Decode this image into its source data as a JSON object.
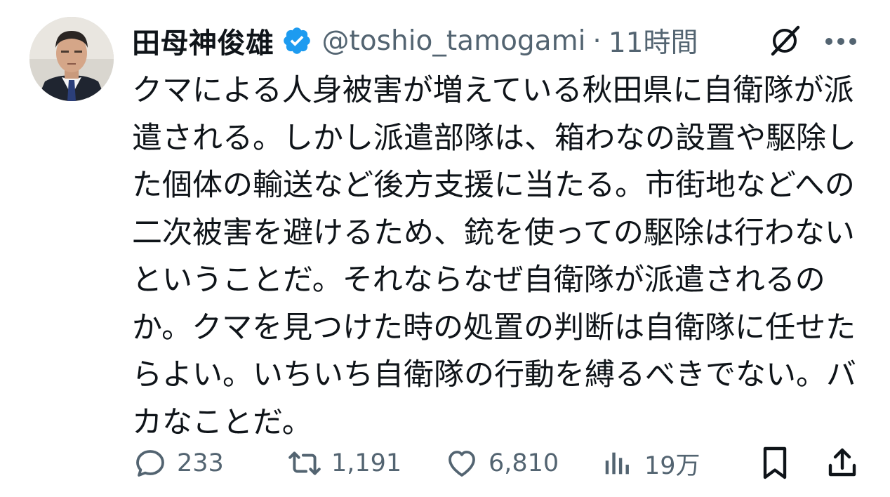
{
  "author": {
    "display_name": "田母神俊雄",
    "handle": "@toshio_tamogami",
    "separator": "·",
    "time": "11時間",
    "verified_icon": "verified-badge-icon",
    "avatar_icon": "profile-photo"
  },
  "header_actions": {
    "grok_icon": "grok-icon",
    "more_icon": "more-dots-icon"
  },
  "tweet": {
    "text": "クマによる人身被害が増えている秋田県に自衛隊が派遣される。しかし派遣部隊は、箱わなの設置や駆除した個体の輸送など後方支援に当たる。市街地などへの二次被害を避けるため、銃を使っての駆除は行わないということだ。それならなぜ自衛隊が派遣されるのか。クマを見つけた時の処置の判断は自衛隊に任せたらよい。いちいち自衛隊の行動を縛るべきでない。バカなことだ。"
  },
  "actions": {
    "reply": {
      "icon": "reply-icon",
      "count": "233"
    },
    "repost": {
      "icon": "repost-icon",
      "count": "1,191"
    },
    "like": {
      "icon": "heart-icon",
      "count": "6,810"
    },
    "views": {
      "icon": "views-bar-icon",
      "count": "19万"
    },
    "bookmark": {
      "icon": "bookmark-icon"
    },
    "share": {
      "icon": "share-icon"
    }
  },
  "colors": {
    "text": "#0f1419",
    "secondary": "#536471",
    "verified": "#1d9bf0",
    "background": "#ffffff"
  }
}
